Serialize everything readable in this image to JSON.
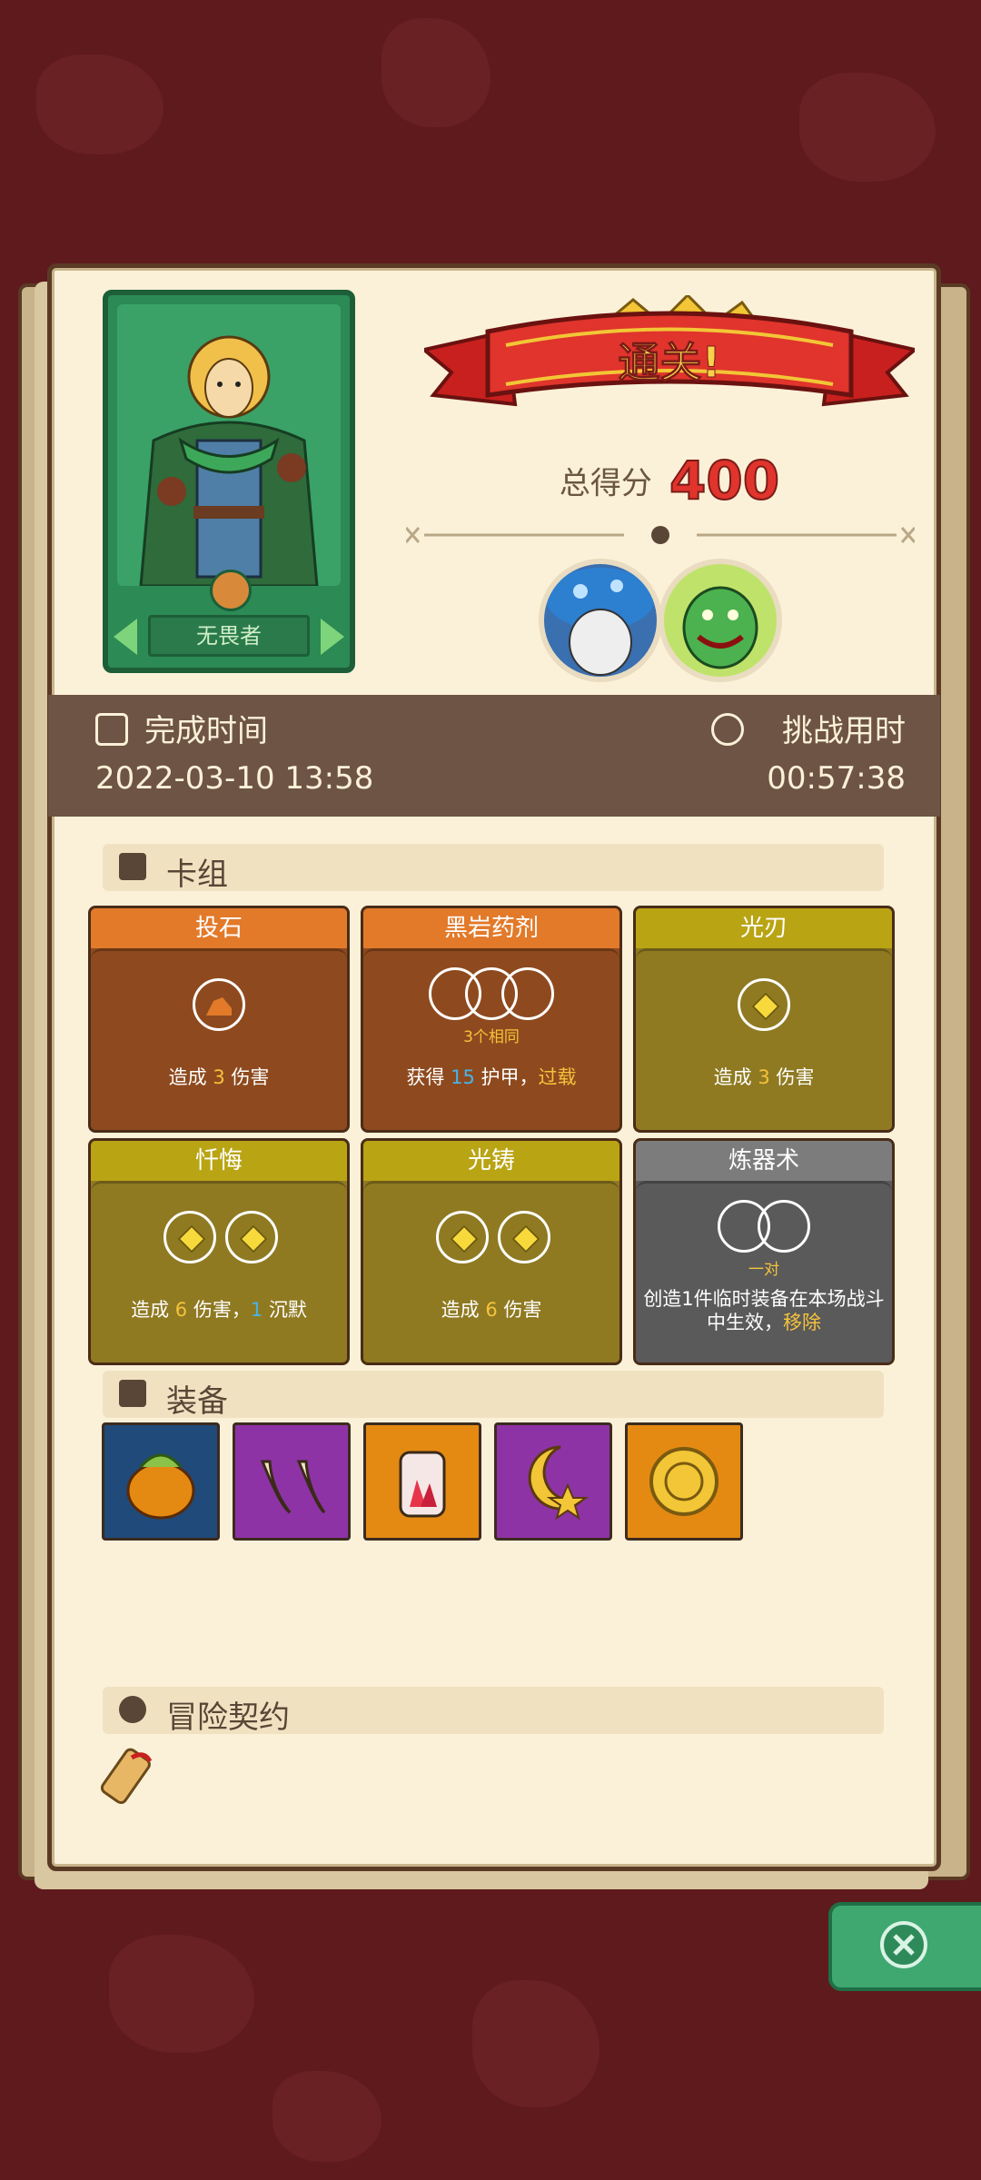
{
  "hero": {
    "name": "无畏者"
  },
  "result": {
    "banner_text": "通关!",
    "score_label": "总得分",
    "score_value": "400"
  },
  "times": {
    "completion_label": "完成时间",
    "completion_value": "2022-03-10 13:58",
    "challenge_label": "挑战用时",
    "challenge_value": "00:57:38"
  },
  "sections": {
    "deck": "卡组",
    "equipment": "装备",
    "contract": "冒险契约"
  },
  "cards": [
    {
      "title": "投石",
      "desc_pre": "造成 ",
      "desc_num": "3",
      "desc_post": " 伤害"
    },
    {
      "title": "黑岩药剂",
      "slot_label": "3个相同",
      "desc_pre": "获得 ",
      "desc_num": "15",
      "desc_mid": " 护甲，",
      "desc_kw": "过载"
    },
    {
      "title": "光刃",
      "desc_pre": "造成 ",
      "desc_num": "3",
      "desc_post": " 伤害"
    },
    {
      "title": "忏悔",
      "desc_pre": "造成 ",
      "desc_num": "6",
      "desc_mid": " 伤害，",
      "desc_num2": "1",
      "desc_post": " 沉默"
    },
    {
      "title": "光铸",
      "desc_pre": "造成 ",
      "desc_num": "6",
      "desc_post": " 伤害"
    },
    {
      "title": "炼器术",
      "slot_label": "一对",
      "desc_pre": "创造1件临时装备在本场战斗中生效，",
      "desc_kw": "移除"
    }
  ],
  "colors": {
    "orange_header": "#e27a2a",
    "orange_body": "#8e4a1e",
    "gold_header": "#b9a414",
    "gold_body": "#8f7a22",
    "gray_header": "#7c7c7c",
    "gray_body": "#5a5a5a"
  },
  "equipment": [
    {
      "icon": "bomb-fruit-icon",
      "color": "#1f4a7a"
    },
    {
      "icon": "claws-icon",
      "color": "#8e33a6"
    },
    {
      "icon": "crystal-jar-icon",
      "color": "#e48a12"
    },
    {
      "icon": "moon-star-icon",
      "color": "#8e33a6"
    },
    {
      "icon": "gold-coin-icon",
      "color": "#e48a12"
    }
  ]
}
